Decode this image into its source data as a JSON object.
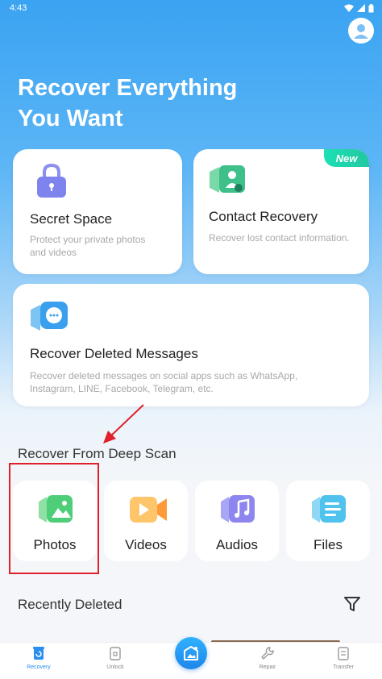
{
  "status_bar": {
    "time": "4:43"
  },
  "hero": {
    "title_line1": "Recover Everything",
    "title_line2": "You Want"
  },
  "cards": {
    "secret_space": {
      "title": "Secret Space",
      "desc_line1": "Protect your private photos",
      "desc_line2": "and videos"
    },
    "contact_recovery": {
      "title": "Contact Recovery",
      "desc": "Recover lost contact information.",
      "badge": "New"
    },
    "messages": {
      "title": "Recover Deleted Messages",
      "desc_line1": "Recover deleted messages on social apps such as WhatsApp,",
      "desc_line2": "Instagram, LINE, Facebook, Telegram, etc."
    }
  },
  "deep_scan": {
    "title": "Recover From Deep Scan",
    "items": [
      {
        "label": "Photos",
        "icon": "photo-icon"
      },
      {
        "label": "Videos",
        "icon": "video-icon"
      },
      {
        "label": "Audios",
        "icon": "music-icon"
      },
      {
        "label": "Files",
        "icon": "file-icon"
      }
    ]
  },
  "recently_deleted": {
    "title": "Recently Deleted",
    "filter_icon": "filter-icon"
  },
  "bottom_nav": {
    "items": [
      {
        "label": "Recovery",
        "icon": "recovery-icon",
        "active": true
      },
      {
        "label": "Unlock",
        "icon": "unlock-icon",
        "active": false
      },
      {
        "label": "Repair",
        "icon": "wrench-icon",
        "active": false
      },
      {
        "label": "Transfer",
        "icon": "transfer-icon",
        "active": false
      }
    ]
  },
  "colors": {
    "accent": "#2c8ef0",
    "annotation_red": "#e0202a",
    "new_badge": "#1de0b5"
  }
}
